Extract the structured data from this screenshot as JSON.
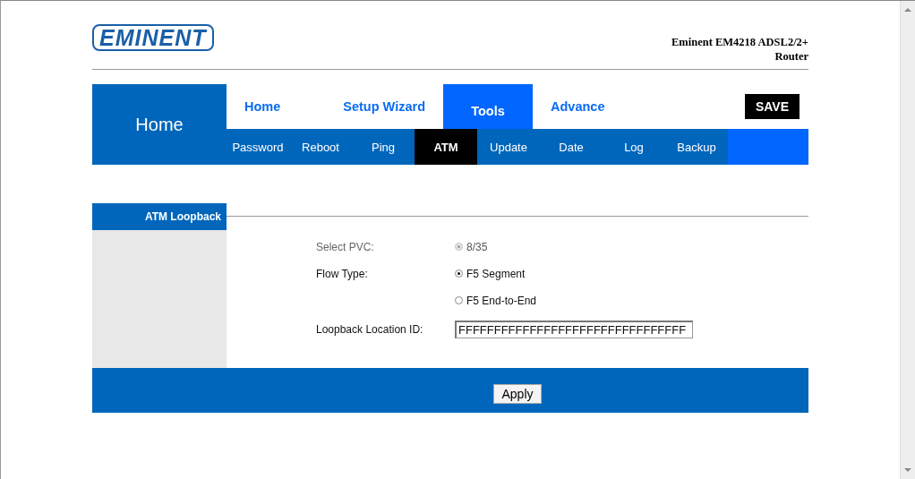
{
  "logo": "EMINENT",
  "product_title": "Eminent EM4218 ADSL2/2+ Router",
  "nav": {
    "section_title": "Home",
    "main_tabs": [
      {
        "label": "Home",
        "selected": false
      },
      {
        "label": "Setup Wizard",
        "selected": false
      },
      {
        "label": "Tools",
        "selected": true
      },
      {
        "label": "Advance",
        "selected": false
      }
    ],
    "save_button": "SAVE",
    "sub_tabs": [
      {
        "label": "Password",
        "selected": false
      },
      {
        "label": "Reboot",
        "selected": false
      },
      {
        "label": "Ping",
        "selected": false
      },
      {
        "label": "ATM",
        "selected": true
      },
      {
        "label": "Update",
        "selected": false
      },
      {
        "label": "Date",
        "selected": false
      },
      {
        "label": "Log",
        "selected": false
      },
      {
        "label": "Backup",
        "selected": false
      }
    ]
  },
  "sidebar": {
    "title": "ATM Loopback"
  },
  "form": [
    {
      "kind": "radio",
      "label": "Select PVC:",
      "disabled": true,
      "options": [
        {
          "label": "8/35",
          "selected": true
        }
      ]
    },
    {
      "kind": "radio",
      "label": "Flow Type:",
      "disabled": false,
      "options": [
        {
          "label": "F5 Segment",
          "selected": true
        },
        {
          "label": "F5 End-to-End",
          "selected": false
        }
      ]
    },
    {
      "kind": "text",
      "label": "Loopback Location ID:",
      "value": "FFFFFFFFFFFFFFFFFFFFFFFFFFFFFFFF"
    }
  ],
  "apply_button": "Apply"
}
